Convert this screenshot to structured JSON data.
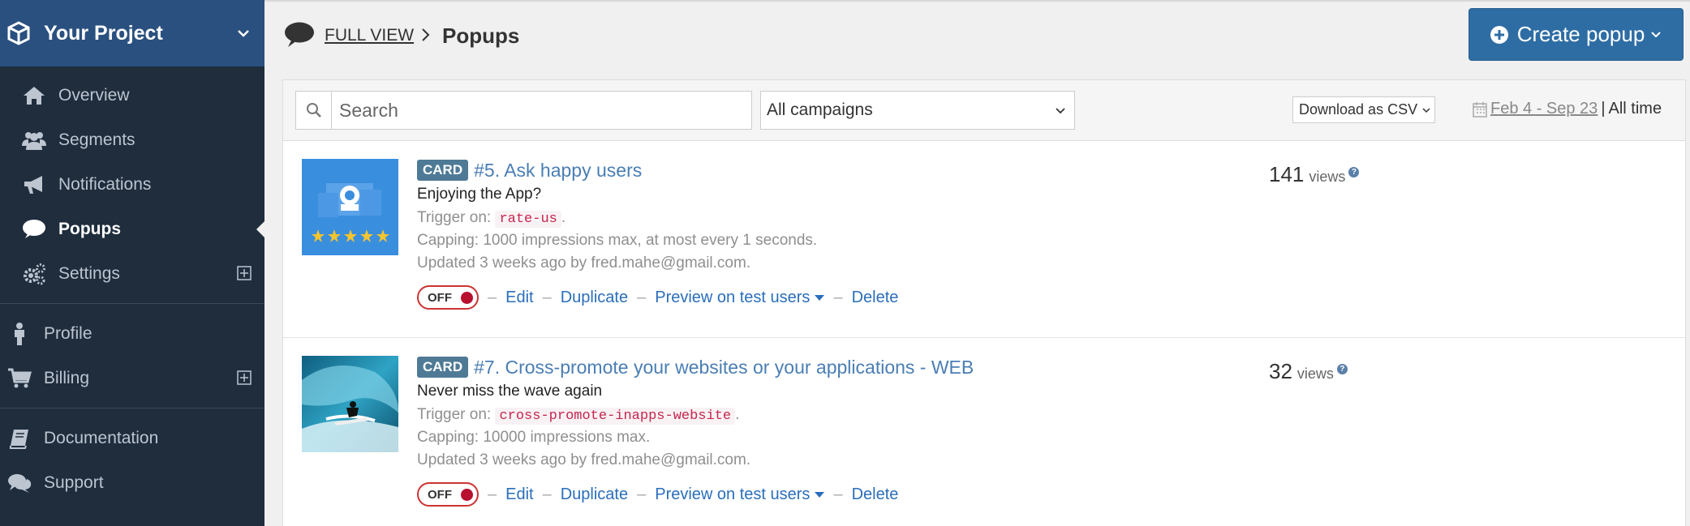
{
  "sidebar": {
    "project_name": "Your Project",
    "items": [
      {
        "label": "Overview",
        "icon": "home-icon"
      },
      {
        "label": "Segments",
        "icon": "users-icon"
      },
      {
        "label": "Notifications",
        "icon": "megaphone-icon"
      },
      {
        "label": "Popups",
        "icon": "comment-icon",
        "active": true
      },
      {
        "label": "Settings",
        "icon": "gears-icon"
      }
    ],
    "items2": [
      {
        "label": "Profile",
        "icon": "person-icon"
      },
      {
        "label": "Billing",
        "icon": "cart-icon"
      }
    ],
    "items3": [
      {
        "label": "Documentation",
        "icon": "book-icon"
      },
      {
        "label": "Support",
        "icon": "comments-icon"
      }
    ]
  },
  "header": {
    "full_view": "FULL VIEW",
    "title": "Popups",
    "create_label": "Create popup"
  },
  "toolbar": {
    "search_placeholder": "Search",
    "campaign_filter": "All campaigns",
    "csv_label": "Download as CSV",
    "date_range": "Feb 4 - Sep 23",
    "date_separator": "|",
    "all_time": "All time"
  },
  "popups": [
    {
      "badge": "CARD",
      "title": "#5. Ask happy users",
      "subtitle": "Enjoying the App?",
      "trigger_label": "Trigger on:",
      "trigger": "rate-us",
      "capping": "Capping: 1000 impressions max, at most every 1 seconds.",
      "updated": "Updated 3 weeks ago by fred.mahe@gmail.com.",
      "toggle": "OFF",
      "views": "141",
      "views_label": "views"
    },
    {
      "badge": "CARD",
      "title": "#7. Cross-promote your websites or your applications - WEB",
      "subtitle": "Never miss the wave again",
      "trigger_label": "Trigger on:",
      "trigger": "cross-promote-inapps-website",
      "capping": "Capping: 10000 impressions max.",
      "updated": "Updated 3 weeks ago by fred.mahe@gmail.com.",
      "toggle": "OFF",
      "views": "32",
      "views_label": "views"
    }
  ],
  "actions": {
    "edit": "Edit",
    "duplicate": "Duplicate",
    "preview": "Preview on test users",
    "delete": "Delete"
  },
  "colors": {
    "sidebar_bg": "#1f2d3d",
    "project_bg": "#2a5080",
    "primary": "#2e6da4",
    "link": "#2a6ebb",
    "badge": "#4e7a96",
    "off": "#b8102f"
  }
}
